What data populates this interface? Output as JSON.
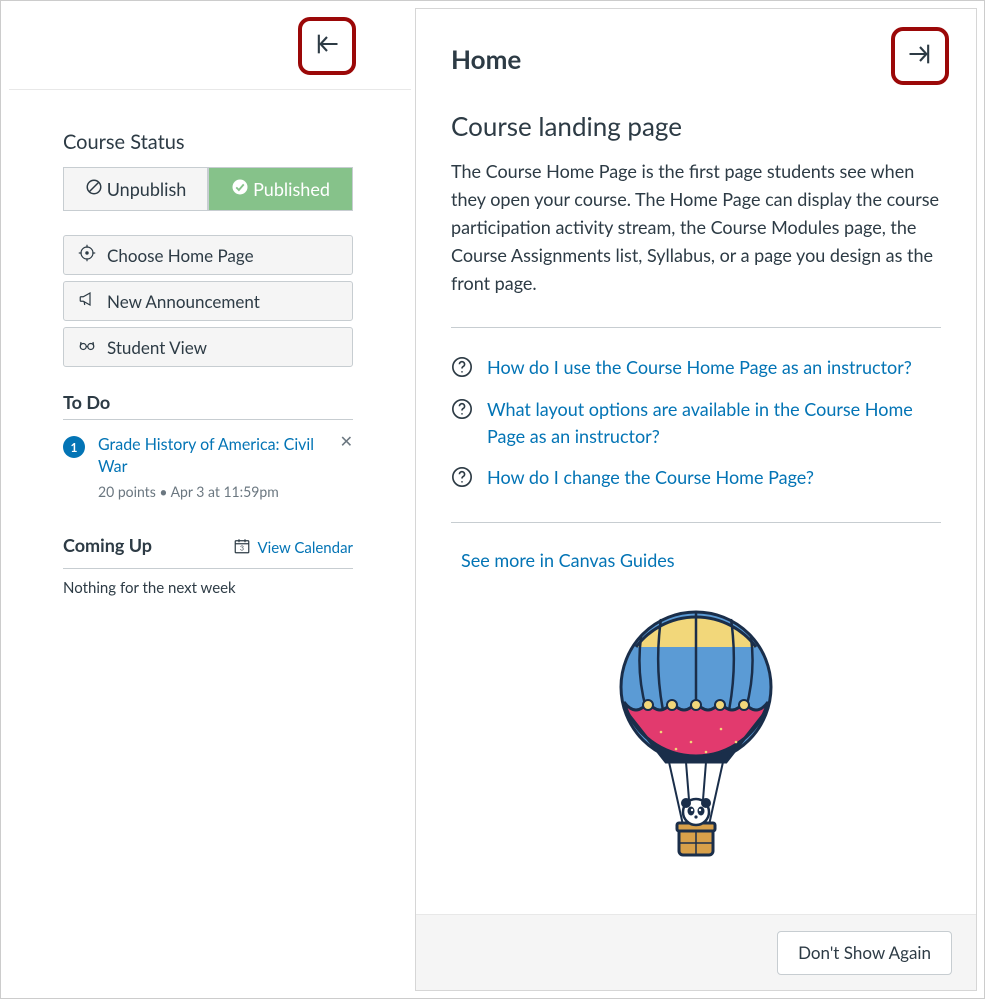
{
  "sidebar": {
    "course_status_title": "Course Status",
    "unpublish_label": "Unpublish",
    "published_label": "Published",
    "actions": {
      "choose_home": "Choose Home Page",
      "new_announcement": "New Announcement",
      "student_view": "Student View"
    },
    "todo": {
      "title": "To Do",
      "badge_count": "1",
      "item_title": "Grade History of America: Civil War",
      "item_meta": "20 points • Apr 3 at 11:59pm"
    },
    "coming_up": {
      "title": "Coming Up",
      "view_calendar": "View Calendar",
      "calendar_day": "3",
      "empty_text": "Nothing for the next week"
    }
  },
  "help": {
    "title": "Home",
    "subtitle": "Course landing page",
    "description": "The Course Home Page is the first page students see when they open your course. The Home Page can display the course participation activity stream, the Course Modules page, the Course Assignments list, Syllabus, or a page you design as the front page.",
    "links": [
      "How do I use the Course Home Page as an instructor?",
      "What layout options are available in the Course Home Page as an instructor?",
      "How do I change the Course Home Page?"
    ],
    "see_more": "See more in Canvas Guides",
    "dont_show_again": "Don't Show Again"
  }
}
